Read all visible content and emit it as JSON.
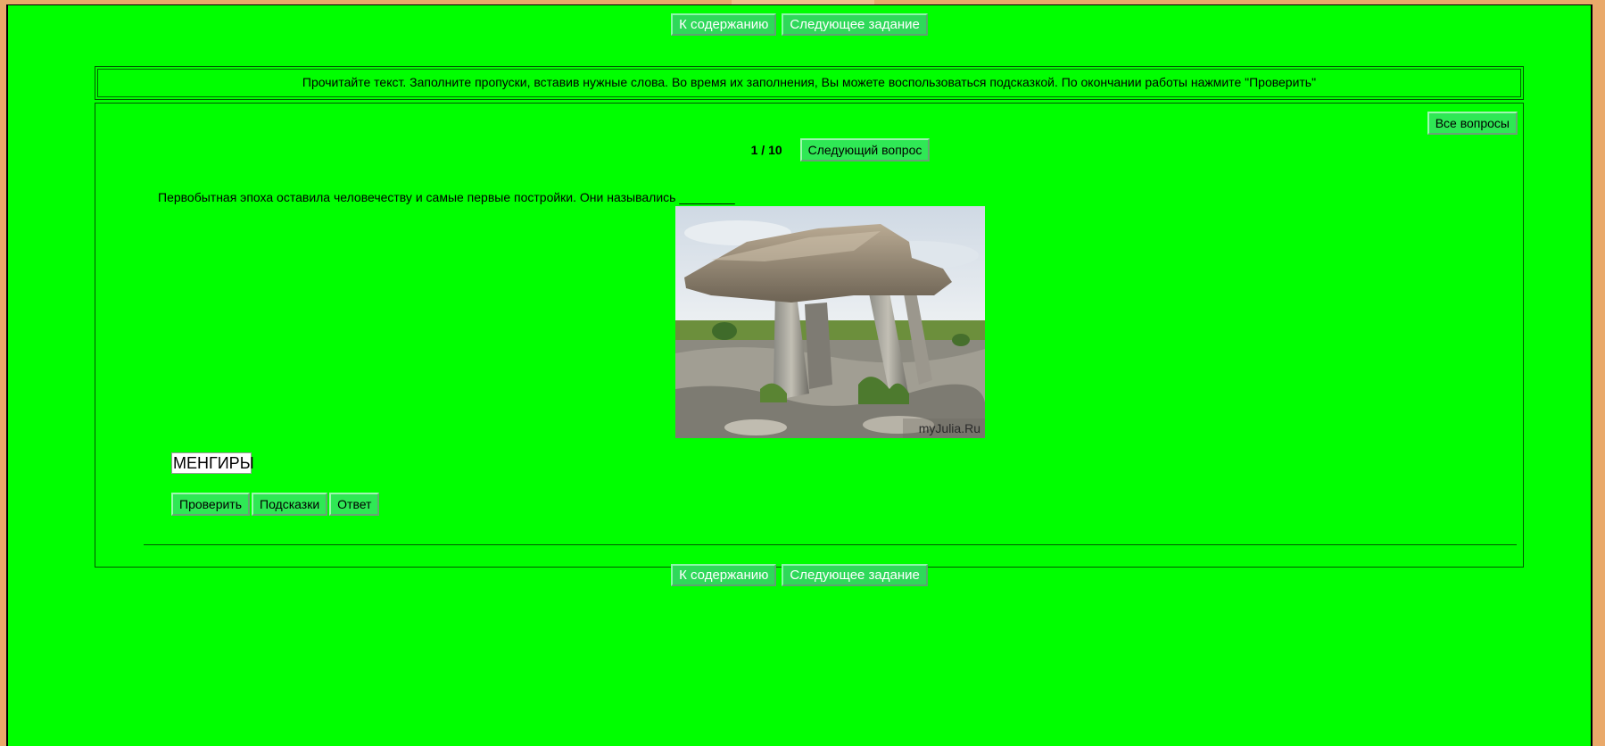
{
  "nav": {
    "contents_label": "К содержанию",
    "next_task_label": "Следующее задание"
  },
  "task": {
    "instructions": "Прочитайте текст. Заполните пропуски, вставив нужные слова. Во время их заполнения, Вы можете воспользоваться подсказкой. По окончании работы нажмите \"Проверить\"",
    "all_questions_label": "Все вопросы",
    "counter": "1 / 10",
    "next_question_label": "Следующий вопрос",
    "question_text": "Первобытная эпоха оставила человечеству и самые первые постройки. Они назывались ________",
    "image_watermark": "myJulia.Ru",
    "answer_value": "МЕНГИРЫ",
    "check_label": "Проверить",
    "hints_label": "Подсказки",
    "answer_label": "Ответ"
  },
  "colors": {
    "page_background": "#00ff00",
    "button_background": "#2fe855"
  }
}
